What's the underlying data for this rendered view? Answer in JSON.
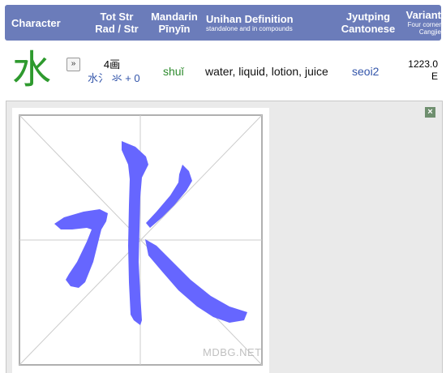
{
  "header": {
    "character": "Character",
    "tot_str": "Tot Str",
    "rad_str": "Rad / Str",
    "mandarin": "Mandarin",
    "pinyin": "Pīnyīn",
    "unihan": "Unihan Definition",
    "unihan_sub": "standalone and in compounds",
    "jyutping": "Jyutping",
    "cantonese": "Cantonese",
    "variant": "Variant",
    "four_corner": "Four corner",
    "cangjie": "Cangjie"
  },
  "entry": {
    "character": "水",
    "expand_icon": "»",
    "strokes": "4画",
    "radical": "水氵 氺 + 0",
    "pinyin": "shuǐ",
    "definition": "water, liquid, lotion, juice",
    "jyutping": "seoi2",
    "four_corner": "1223.0",
    "cangjie": "E"
  },
  "panel": {
    "close_icon": "×",
    "watermark": "MDBG.NET"
  },
  "colors": {
    "header_bg": "#6b7cba",
    "character": "#2e9a2e",
    "stroke_fill": "#6666ff"
  }
}
